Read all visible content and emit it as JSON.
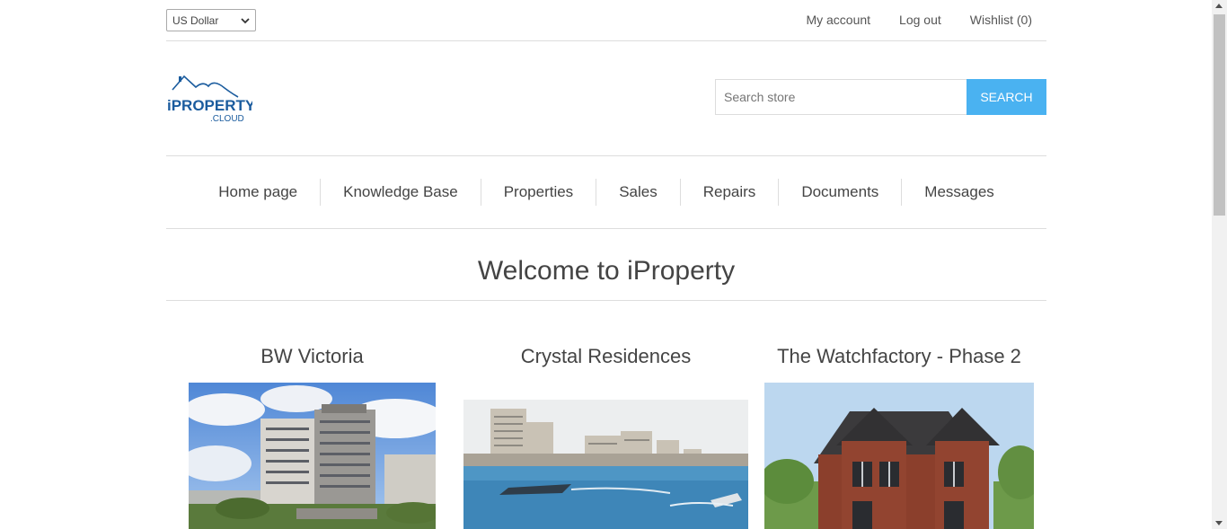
{
  "currency": {
    "selected": "US Dollar"
  },
  "header_links": [
    "My account",
    "Log out",
    "Wishlist (0)"
  ],
  "logo": {
    "text": "iPROPERTY",
    "sub": ".CLOUD",
    "color": "#1b5c9e"
  },
  "search": {
    "placeholder": "Search store",
    "button": "Search"
  },
  "menu": [
    "Home page",
    "Knowledge Base",
    "Properties",
    "Sales",
    "Repairs",
    "Documents",
    "Messages"
  ],
  "page_title": "Welcome to iProperty",
  "properties": [
    {
      "title": "BW Victoria"
    },
    {
      "title": "Crystal Residences"
    },
    {
      "title": "The Watchfactory - Phase 2"
    }
  ],
  "colors": {
    "accent": "#4ab2f1",
    "border": "#dddddd",
    "text": "#444444"
  }
}
